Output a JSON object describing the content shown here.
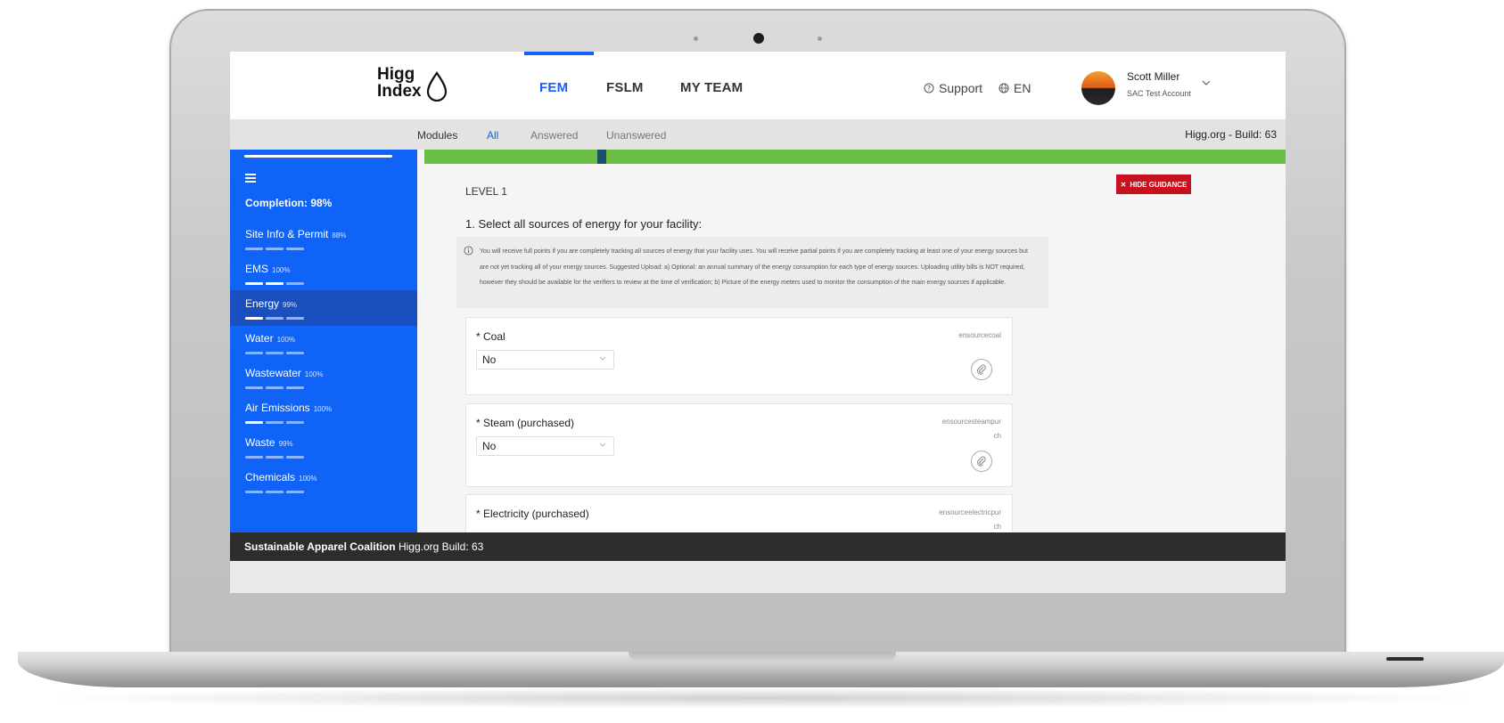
{
  "nav": {
    "logo_line1": "Higg",
    "logo_line2": "Index",
    "tabs": [
      {
        "label": "FEM",
        "active": true
      },
      {
        "label": "FSLM",
        "active": false
      },
      {
        "label": "MY TEAM",
        "active": false
      }
    ],
    "support_label": "Support",
    "language_label": "EN",
    "user_name": "Scott Miller",
    "user_account": "SAC Test Account"
  },
  "module_bar": {
    "label": "Modules",
    "filters": [
      {
        "label": "All",
        "active": true
      },
      {
        "label": "Answered",
        "active": false
      },
      {
        "label": "Unanswered",
        "active": false
      }
    ],
    "build": "Higg.org - Build: 63"
  },
  "sidebar": {
    "completion": "Completion: 98%",
    "items": [
      {
        "name": "Site Info & Permit",
        "pct": "88%",
        "bars_on": 0,
        "active": false
      },
      {
        "name": "EMS",
        "pct": "100%",
        "bars_on": 2,
        "active": false
      },
      {
        "name": "Energy",
        "pct": "99%",
        "bars_on": 1,
        "active": true
      },
      {
        "name": "Water",
        "pct": "100%",
        "bars_on": 0,
        "active": false
      },
      {
        "name": "Wastewater",
        "pct": "100%",
        "bars_on": 0,
        "active": false
      },
      {
        "name": "Air Emissions",
        "pct": "100%",
        "bars_on": 1,
        "active": false
      },
      {
        "name": "Waste",
        "pct": "99%",
        "bars_on": 0,
        "active": false
      },
      {
        "name": "Chemicals",
        "pct": "100%",
        "bars_on": 0,
        "active": false
      }
    ]
  },
  "content": {
    "hide_guidance": "HIDE GUIDANCE",
    "level": "LEVEL 1",
    "question": "1. Select all sources of energy for your facility:",
    "guidance": "You will receive full points if you are completely tracking all sources of energy that your facility uses. You will receive partial points if you are completely tracking at least one of your energy sources but are not yet tracking all of your energy sources. Suggested Upload: a) Optional: an annual summary of the energy consumption for each type of energy sources. Uploading utility bills is NOT required, however they should be available for the verifiers to review at the time of verification; b) Picture of the energy meters used to monitor the consumption of the main energy sources if applicable.",
    "sources": [
      {
        "label": "* Coal",
        "code": "ensourcecoal",
        "value": "No"
      },
      {
        "label": "* Steam (purchased)",
        "code": "ensourcesteampurch",
        "value": "No"
      },
      {
        "label": "* Electricity (purchased)",
        "code": "ensourceelectricpurch",
        "value": ""
      }
    ]
  },
  "footer": {
    "org": "Sustainable Apparel Coalition",
    "build": "Higg.org Build: 63"
  }
}
